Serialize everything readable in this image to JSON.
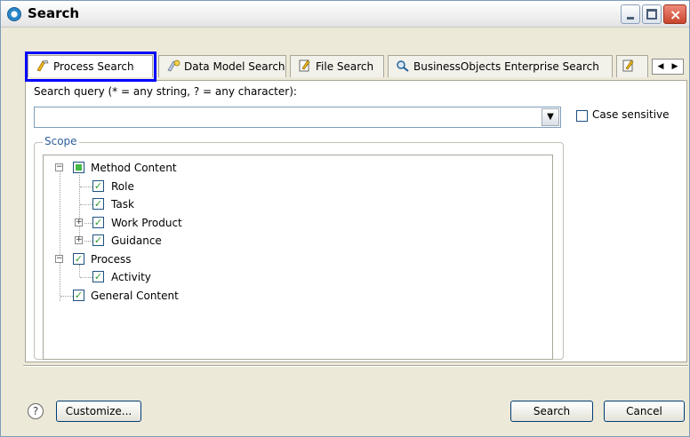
{
  "window": {
    "title": "Search"
  },
  "tabs": [
    {
      "label": "Process Search"
    },
    {
      "label": "Data Model Search"
    },
    {
      "label": "File Search"
    },
    {
      "label": "BusinessObjects Enterprise Search"
    }
  ],
  "query": {
    "label": "Search query (* = any string, ? = any character):",
    "value": "",
    "case_sensitive_label": "Case sensitive"
  },
  "scope": {
    "legend": "Scope",
    "items": [
      {
        "label": "Method Content"
      },
      {
        "label": "Role"
      },
      {
        "label": "Task"
      },
      {
        "label": "Work Product"
      },
      {
        "label": "Guidance"
      },
      {
        "label": "Process"
      },
      {
        "label": "Activity"
      },
      {
        "label": "General Content"
      }
    ]
  },
  "footer": {
    "help_symbol": "?",
    "customize_label": "Customize...",
    "search_label": "Search",
    "cancel_label": "Cancel"
  }
}
